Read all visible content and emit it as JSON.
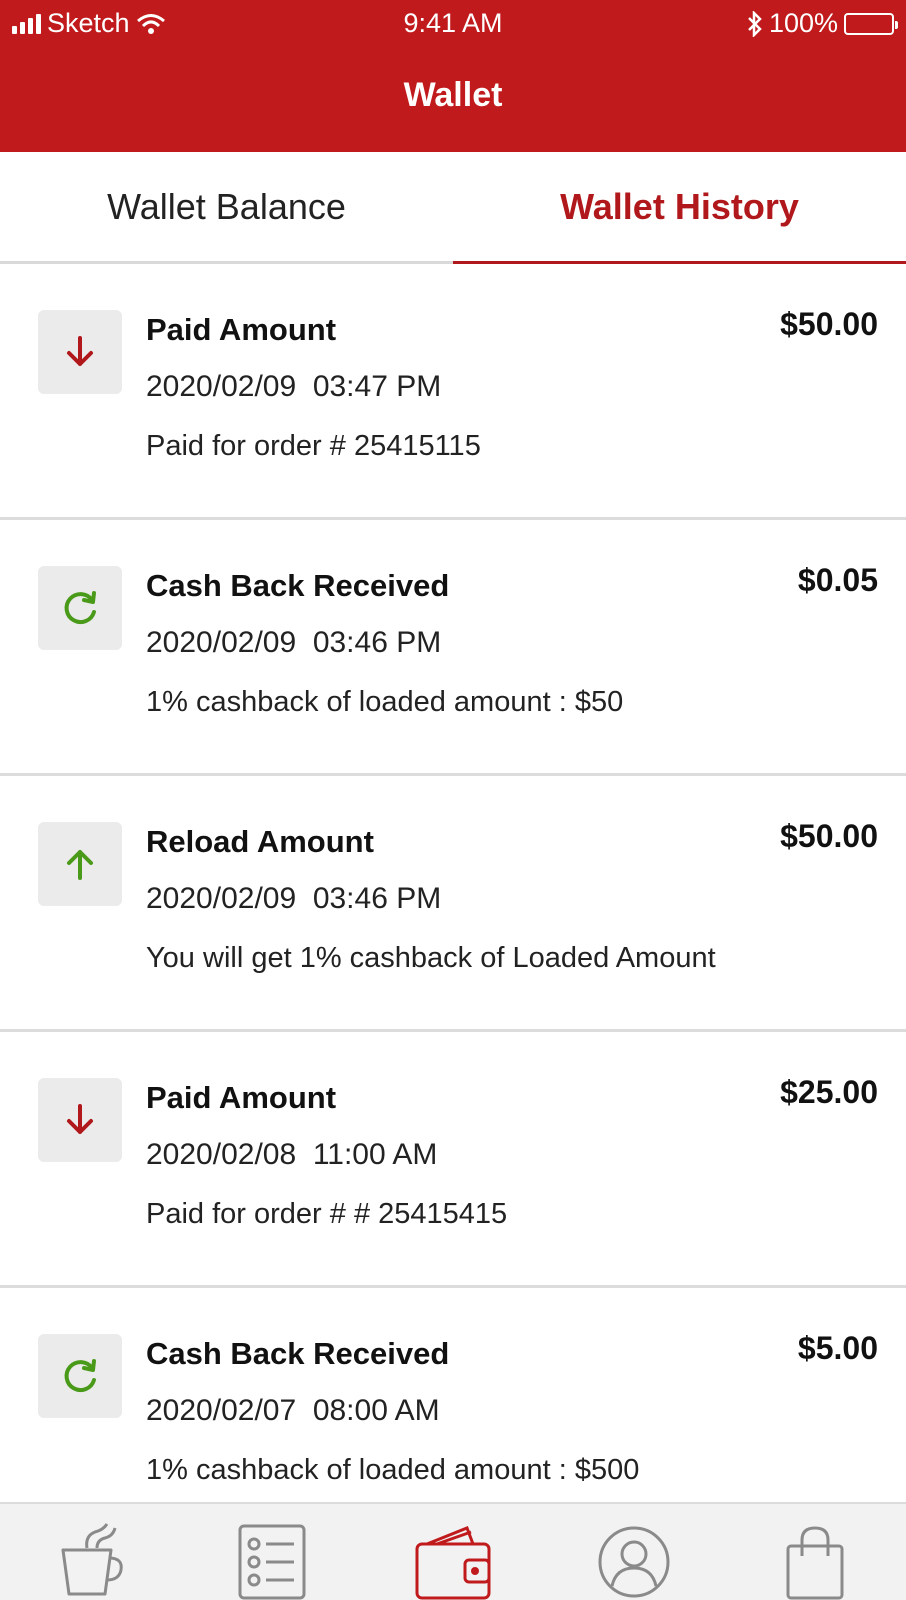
{
  "status_bar": {
    "carrier": "Sketch",
    "time": "9:41 AM",
    "battery": "100%"
  },
  "nav": {
    "title": "Wallet"
  },
  "tabs": [
    {
      "label": "Wallet Balance",
      "active": false
    },
    {
      "label": "Wallet History",
      "active": true
    }
  ],
  "colors": {
    "brand": "#c01a1c",
    "debit_icon": "#b0181b",
    "credit_icon": "#4a9a1a",
    "icon_bg": "#ebebeb"
  },
  "transactions": [
    {
      "icon": "arrow-down-icon",
      "title": "Paid Amount",
      "datetime": "2020/02/09  03:47 PM",
      "description": "Paid for order # 25415115",
      "amount": "$50.00"
    },
    {
      "icon": "cashback-icon",
      "title": "Cash Back Received",
      "datetime": "2020/02/09  03:46 PM",
      "description": "1% cashback of loaded amount : $50",
      "amount": "$0.05"
    },
    {
      "icon": "arrow-up-icon",
      "title": "Reload Amount",
      "datetime": "2020/02/09  03:46 PM",
      "description": "You will get 1% cashback of Loaded Amount",
      "amount": "$50.00"
    },
    {
      "icon": "arrow-down-icon",
      "title": "Paid Amount",
      "datetime": "2020/02/08  11:00 AM",
      "description": "Paid for order # # 25415415",
      "amount": "$25.00"
    },
    {
      "icon": "cashback-icon",
      "title": "Cash Back Received",
      "datetime": "2020/02/07  08:00 AM",
      "description": "1% cashback of loaded amount : $500",
      "amount": "$5.00"
    }
  ],
  "bottom_nav": [
    {
      "icon": "coffee-cup-icon",
      "active": false
    },
    {
      "icon": "order-list-icon",
      "active": false
    },
    {
      "icon": "wallet-icon",
      "active": true
    },
    {
      "icon": "profile-icon",
      "active": false
    },
    {
      "icon": "shopping-bag-icon",
      "active": false
    }
  ]
}
